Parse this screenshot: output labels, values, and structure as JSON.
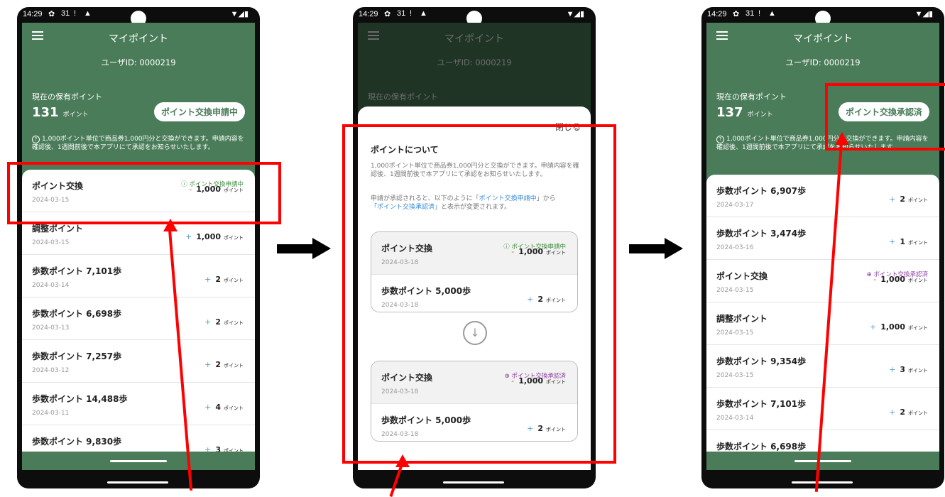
{
  "status": {
    "time": "14:29",
    "gear": "✿",
    "cal": "31",
    "ex": "!",
    "cloud": "▲",
    "sig": "▼◢▮"
  },
  "app": {
    "title": "マイポイント",
    "user_id": "ユーザID: 0000219",
    "holding_label": "現在の保有ポイント",
    "point_unit": "ポイント",
    "note": "1,000ポイント単位で商品券1,000円分と交換ができます。申請内容を確認後、1週間前後で本アプリにて承認をお知らせいたします。",
    "note_icon": "?"
  },
  "screen1": {
    "points": "131",
    "button": "ポイント交換申請中",
    "rows": [
      {
        "title": "ポイント交換",
        "date": "2024-03-15",
        "status": "ポイント交換申請中",
        "sign": "-",
        "value": "1,000"
      },
      {
        "title": "調整ポイント",
        "date": "2024-03-15",
        "sign": "+",
        "value": "1,000"
      },
      {
        "title": "歩数ポイント 7,101歩",
        "date": "2024-03-14",
        "sign": "+",
        "value": "2"
      },
      {
        "title": "歩数ポイント 6,698歩",
        "date": "2024-03-13",
        "sign": "+",
        "value": "2"
      },
      {
        "title": "歩数ポイント 7,257歩",
        "date": "2024-03-12",
        "sign": "+",
        "value": "2"
      },
      {
        "title": "歩数ポイント 14,488歩",
        "date": "2024-03-11",
        "sign": "+",
        "value": "4"
      },
      {
        "title": "歩数ポイント 9,830歩",
        "date": "",
        "sign": "+",
        "value": "3"
      }
    ]
  },
  "screen2": {
    "close": "閉じる",
    "heading": "ポイントについて",
    "p1": "1,000ポイント単位で商品券1,000円分と交換ができます。申請内容を確認後、1週間前後で本アプリにて承認をお知らせいたします。",
    "p2a": "申請が承認されると、以下のように「",
    "p2b": "ポイント交換申請中",
    "p2c": "」から",
    "p2d": "「ポイント交換承認済」",
    "p2e": "と表示が変更されます。",
    "before": [
      {
        "title": "ポイント交換",
        "date": "2024-03-18",
        "status": "ポイント交換申請中",
        "sign": "-",
        "value": "1,000"
      },
      {
        "title": "歩数ポイント 5,000歩",
        "date": "2024-03-18",
        "sign": "+",
        "value": "2"
      }
    ],
    "after": [
      {
        "title": "ポイント交換",
        "date": "2024-03-18",
        "status": "ポイント交換承認済",
        "sign": "-",
        "value": "1,000"
      },
      {
        "title": "歩数ポイント 5,000歩",
        "date": "2024-03-18",
        "sign": "+",
        "value": "2"
      }
    ],
    "arrow": "↓"
  },
  "screen3": {
    "points": "137",
    "button": "ポイント交換承認済",
    "rows": [
      {
        "title": "歩数ポイント 6,907歩",
        "date": "2024-03-17",
        "sign": "+",
        "value": "2"
      },
      {
        "title": "歩数ポイント 3,474歩",
        "date": "2024-03-16",
        "sign": "+",
        "value": "1"
      },
      {
        "title": "ポイント交換",
        "date": "2024-03-15",
        "status": "ポイント交換承認済",
        "sign": "-",
        "value": "1,000"
      },
      {
        "title": "調整ポイント",
        "date": "2024-03-15",
        "sign": "+",
        "value": "1,000"
      },
      {
        "title": "歩数ポイント 9,354歩",
        "date": "2024-03-15",
        "sign": "+",
        "value": "3"
      },
      {
        "title": "歩数ポイント 7,101歩",
        "date": "2024-03-14",
        "sign": "+",
        "value": "2"
      },
      {
        "title": "歩数ポイント 6,698歩",
        "date": "",
        "sign": "+",
        "value": "2"
      }
    ]
  },
  "colors": {
    "green": "#4a7c59",
    "red": "#ff0000",
    "pending": "#3a8a3a",
    "approved": "#8a3aa0"
  }
}
